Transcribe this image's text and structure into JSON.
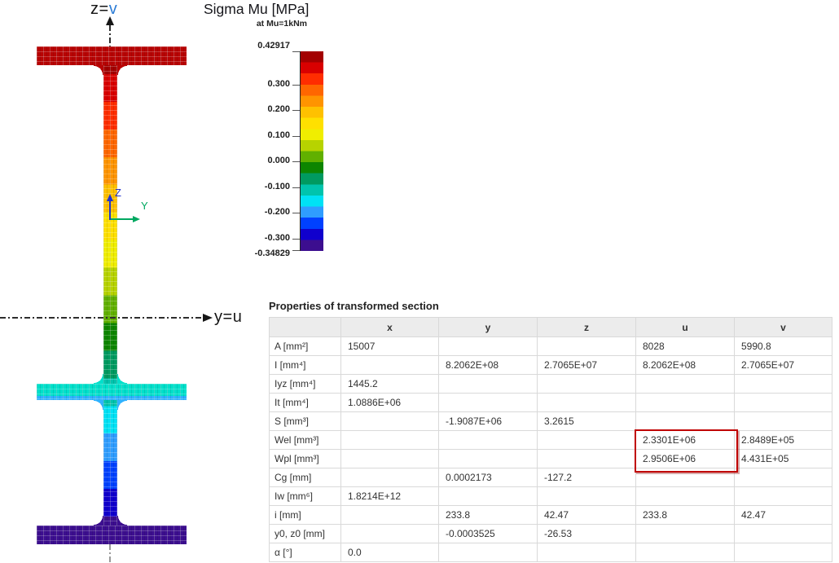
{
  "figure": {
    "top_axis_prefix": "z=",
    "top_axis_letter": "v",
    "top_axis_letter_color": "#2d7dd6",
    "right_axis_prefix": "y=",
    "right_axis_letter": "u",
    "right_axis_letter_color": "#1c1c1c",
    "local_axes": {
      "z": "Z",
      "y": "Y",
      "z_color": "#2233cc",
      "y_color": "#00a860"
    },
    "flange_top_color": "#b80404",
    "flange_mid_top_color": "#00e0cb",
    "flange_mid_bottom_color": "#2fb2ff",
    "flange_bottom_color": "#3c0e8f"
  },
  "legend": {
    "title": "Sigma Mu [MPa]",
    "subtitle": "at Mu=1kNm",
    "max_label": "0.42917",
    "min_label": "-0.34829",
    "ticks": [
      "0.300",
      "0.200",
      "0.100",
      "0.000",
      "-0.100",
      "-0.200",
      "-0.300"
    ],
    "band_colors": [
      "#a30000",
      "#d90000",
      "#ff2d00",
      "#ff6600",
      "#ff9400",
      "#ffc100",
      "#ffe000",
      "#f0ee00",
      "#b7d300",
      "#61b000",
      "#0d8500",
      "#009a60",
      "#00c4ad",
      "#00e2f5",
      "#2f9dff",
      "#0041ff",
      "#1000cd",
      "#3c0e8f"
    ]
  },
  "table": {
    "title": "Properties of transformed section",
    "columns": [
      "",
      "x",
      "y",
      "z",
      "u",
      "v"
    ],
    "rows": [
      {
        "label": "A [mm²]",
        "values": [
          "15007",
          "",
          "",
          "8028",
          "5990.8"
        ]
      },
      {
        "label": "I [mm⁴]",
        "values": [
          "",
          "8.2062E+08",
          "2.7065E+07",
          "8.2062E+08",
          "2.7065E+07"
        ]
      },
      {
        "label": "Iyz [mm⁴]",
        "values": [
          "1445.2",
          "",
          "",
          "",
          ""
        ]
      },
      {
        "label": "It [mm⁴]",
        "values": [
          "1.0886E+06",
          "",
          "",
          "",
          ""
        ]
      },
      {
        "label": "S [mm³]",
        "values": [
          "",
          "-1.9087E+06",
          "3.2615",
          "",
          ""
        ]
      },
      {
        "label": "Wel [mm³]",
        "values": [
          "",
          "",
          "",
          "2.3301E+06",
          "2.8489E+05"
        ]
      },
      {
        "label": "Wpl [mm³]",
        "values": [
          "",
          "",
          "",
          "2.9506E+06",
          "4.431E+05"
        ]
      },
      {
        "label": "Cg [mm]",
        "values": [
          "",
          "0.0002173",
          "-127.2",
          "",
          ""
        ]
      },
      {
        "label": "Iw [mm⁶]",
        "values": [
          "1.8214E+12",
          "",
          "",
          "",
          ""
        ]
      },
      {
        "label": "i [mm]",
        "values": [
          "",
          "233.8",
          "42.47",
          "233.8",
          "42.47"
        ]
      },
      {
        "label": "y0, z0 [mm]",
        "values": [
          "",
          "-0.0003525",
          "-26.53",
          "",
          ""
        ]
      },
      {
        "label": "α [°]",
        "values": [
          "0.0",
          "",
          "",
          "",
          ""
        ]
      }
    ],
    "highlight_color": "#c00000"
  }
}
